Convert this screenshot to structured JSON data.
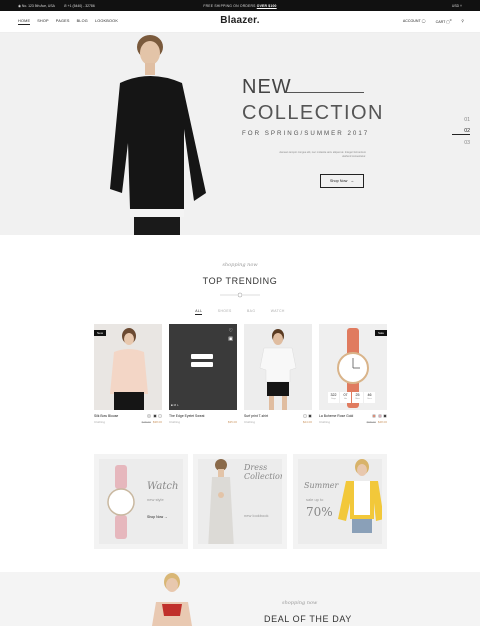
{
  "topbar": {
    "address": "No. 123 5th Ave, USA",
    "phone": "+1 (5440) - 32786",
    "shipping_text": "FREE SHIPPING ON ORDERS",
    "shipping_cta": "OVER $100",
    "currency": "USD"
  },
  "header": {
    "logo": "Blaazer.",
    "nav": [
      "HOME",
      "SHOP",
      "PAGES",
      "BLOG",
      "LOOKBOOK"
    ],
    "account": "ACCOUNT",
    "cart": "CART",
    "cart_count": "0"
  },
  "hero": {
    "title1": "NEW",
    "title2": "COLLECTION",
    "subtitle": "FOR SPRING/SUMMER 2017",
    "description": "Aenean tempor congue elit, nec molestie arcu aliquet at. Integer fermentum eleifend consectetur.",
    "button": "Shop Now",
    "slides": [
      "01",
      "02",
      "03"
    ]
  },
  "trending": {
    "script": "shopping now",
    "title": "TOP TRENDING",
    "filters": [
      "ALL",
      "SHOES",
      "BAG",
      "WATCH"
    ]
  },
  "products": [
    {
      "name": "Silk Bow Blouse",
      "category": "Clothing",
      "old_price": "$48.00",
      "price": "$38.00",
      "badge": "New"
    },
    {
      "name": "The Edge Eyelet Sweat",
      "category": "Clothing",
      "price": "$35.00",
      "badge": ""
    },
    {
      "name": "Surf print T-shirt",
      "category": "Clothing",
      "price": "$24.00",
      "badge": ""
    },
    {
      "name": "La Boheme Rose Gold",
      "category": "Clothing",
      "old_price": "$68.00",
      "price": "$48.00",
      "badge": "Sale",
      "countdown": [
        {
          "v": "322",
          "l": "Days"
        },
        {
          "v": "07",
          "l": "Hrs"
        },
        {
          "v": "25",
          "l": "Mins"
        },
        {
          "v": "46",
          "l": "Secs"
        }
      ]
    }
  ],
  "promos": [
    {
      "big": "Watch",
      "small": "new style",
      "link": "Shop Now"
    },
    {
      "big": "Dress Collection",
      "small": "new lookbook"
    },
    {
      "big": "Summer",
      "small": "sale up to",
      "pct": "70%"
    }
  ],
  "deal": {
    "script": "shopping now",
    "title": "DEAL OF THE DAY"
  },
  "colors": {
    "topbar_bg": "#111111",
    "hero_bg": "#f1f1f1",
    "accent": "#c99a6e"
  }
}
